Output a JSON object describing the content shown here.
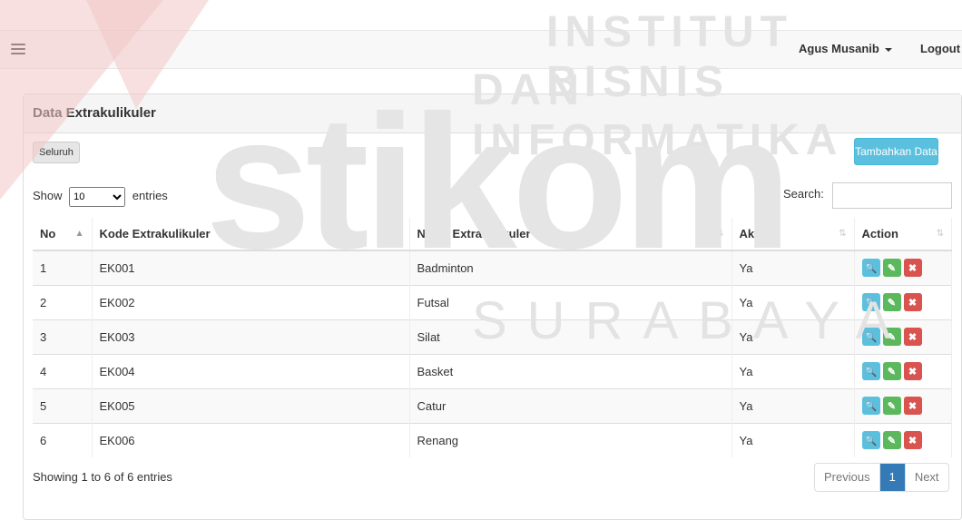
{
  "navbar": {
    "user": "Agus Musanib",
    "logout": "Logout"
  },
  "panel": {
    "title": "Data Extrakulikuler"
  },
  "toolbar": {
    "all_label": "Seluruh",
    "add_label": "Tambahkan Data"
  },
  "length": {
    "show": "Show",
    "value": "10",
    "entries": "entries"
  },
  "search": {
    "label": "Search:",
    "value": ""
  },
  "table": {
    "headers": {
      "no": "No",
      "kode": "Kode Extrakulikuler",
      "nama": "Nama Extrakulikuler",
      "aktif": "Aktif",
      "action": "Action"
    },
    "rows": [
      {
        "no": "1",
        "kode": "EK001",
        "nama": "Badminton",
        "aktif": "Ya"
      },
      {
        "no": "2",
        "kode": "EK002",
        "nama": "Futsal",
        "aktif": "Ya"
      },
      {
        "no": "3",
        "kode": "EK003",
        "nama": "Silat",
        "aktif": "Ya"
      },
      {
        "no": "4",
        "kode": "EK004",
        "nama": "Basket",
        "aktif": "Ya"
      },
      {
        "no": "5",
        "kode": "EK005",
        "nama": "Catur",
        "aktif": "Ya"
      },
      {
        "no": "6",
        "kode": "EK006",
        "nama": "Renang",
        "aktif": "Ya"
      }
    ]
  },
  "footer": {
    "info": "Showing 1 to 6 of 6 entries",
    "prev": "Previous",
    "page": "1",
    "next": "Next"
  },
  "watermark": {
    "line1": "INSTITUT BISNIS",
    "line2": "DAN INFORMATIKA",
    "brand": "stikom",
    "city": "SURABAYA"
  },
  "colors": {
    "accent": "#337ab7",
    "info": "#5bc0de",
    "success": "#5cb85c",
    "danger": "#d9534f"
  }
}
